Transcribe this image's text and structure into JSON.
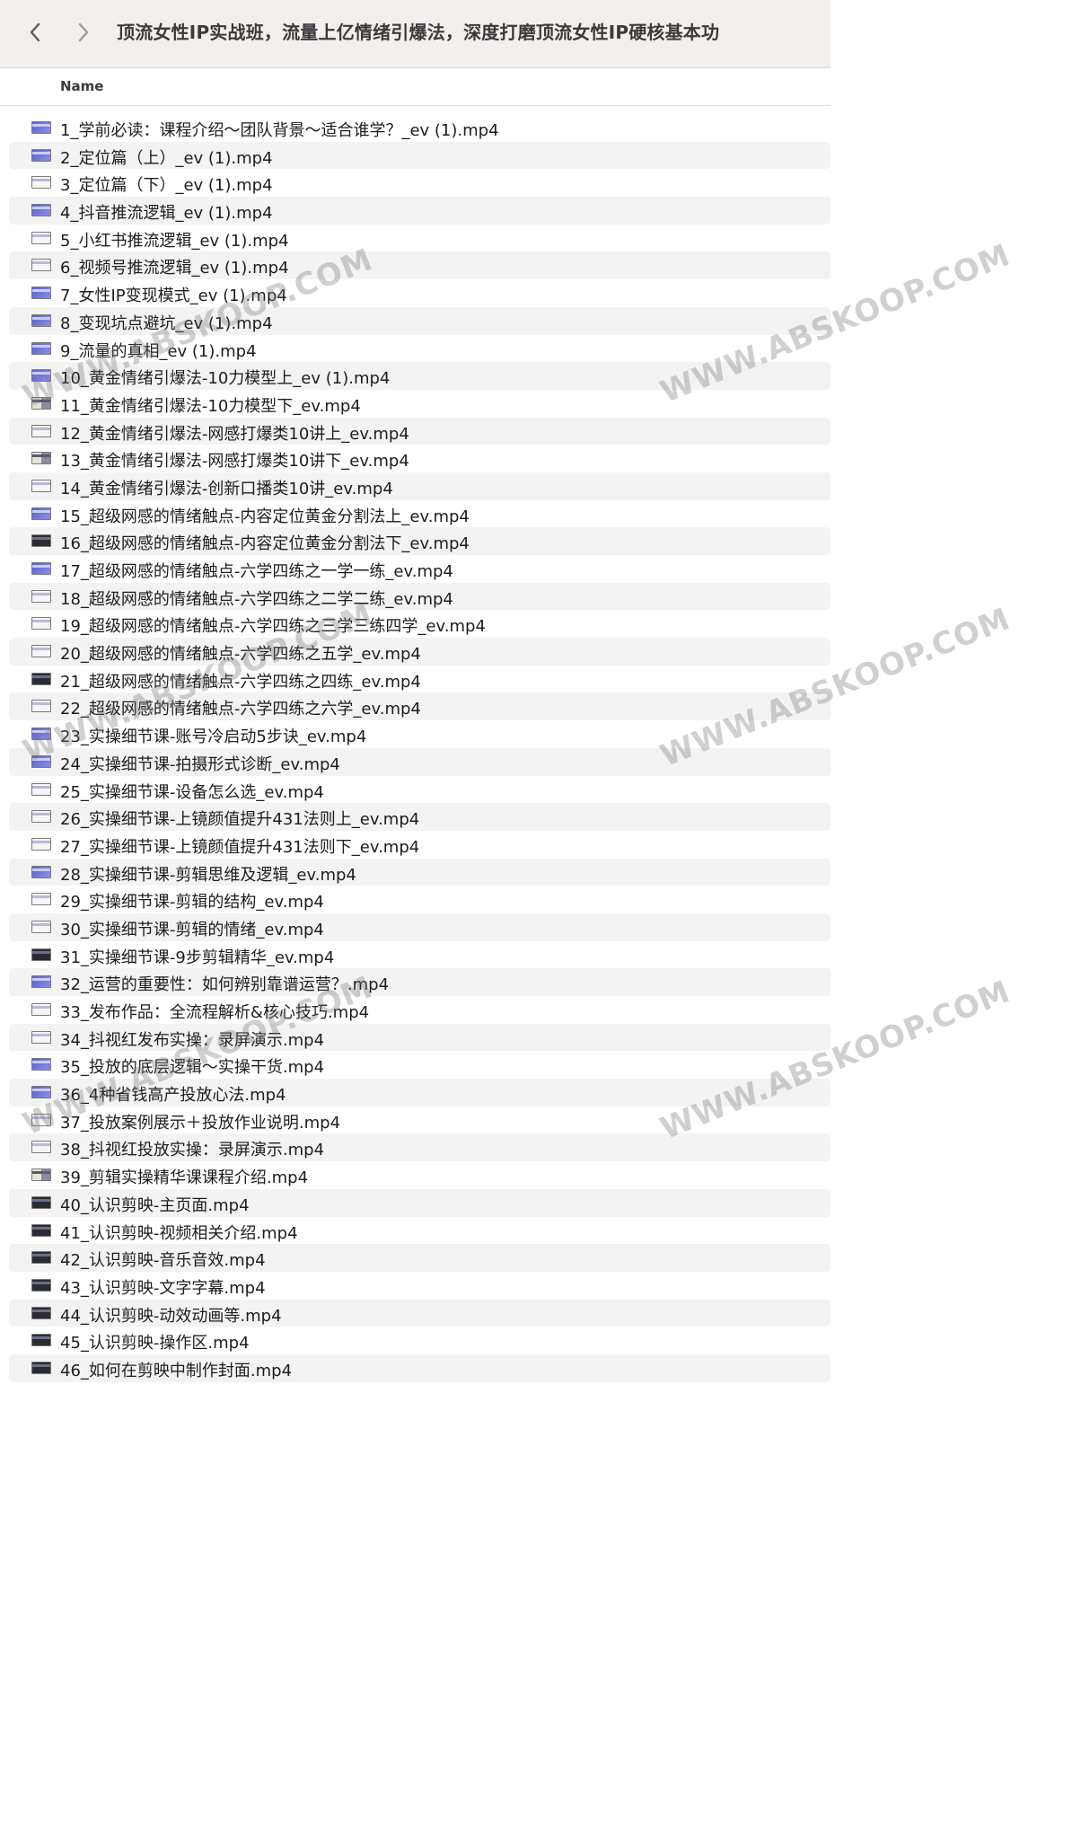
{
  "window": {
    "title": "顶流女性IP实战班，流量上亿情绪引爆法，深度打磨顶流女性IP硬核基本功"
  },
  "toolbar": {
    "back_icon": "chevron-left-icon",
    "forward_icon": "chevron-right-icon"
  },
  "columns": {
    "name": "Name"
  },
  "files": [
    {
      "name": "1_学前必读：课程介绍～团队背景～适合谁学？_ev (1).mp4",
      "thumb": "blue"
    },
    {
      "name": "2_定位篇（上）_ev (1).mp4",
      "thumb": "blue"
    },
    {
      "name": "3_定位篇（下）_ev (1).mp4",
      "thumb": "light"
    },
    {
      "name": "4_抖音推流逻辑_ev (1).mp4",
      "thumb": "blue"
    },
    {
      "name": "5_小红书推流逻辑_ev (1).mp4",
      "thumb": "light"
    },
    {
      "name": "6_视频号推流逻辑_ev (1).mp4",
      "thumb": "light"
    },
    {
      "name": "7_女性IP变现模式_ev (1).mp4",
      "thumb": "blue"
    },
    {
      "name": "8_变现坑点避坑_ev (1).mp4",
      "thumb": "blue"
    },
    {
      "name": "9_流量的真相_ev (1).mp4",
      "thumb": "blue"
    },
    {
      "name": "10_黄金情绪引爆法-10力模型上_ev (1).mp4",
      "thumb": "blue"
    },
    {
      "name": "11_黄金情绪引爆法-10力模型下_ev.mp4",
      "thumb": "mixed"
    },
    {
      "name": "12_黄金情绪引爆法-网感打爆类10讲上_ev.mp4",
      "thumb": "light"
    },
    {
      "name": "13_黄金情绪引爆法-网感打爆类10讲下_ev.mp4",
      "thumb": "mixed"
    },
    {
      "name": "14_黄金情绪引爆法-创新口播类10讲_ev.mp4",
      "thumb": "light"
    },
    {
      "name": "15_超级网感的情绪触点-内容定位黄金分割法上_ev.mp4",
      "thumb": "blue"
    },
    {
      "name": "16_超级网感的情绪触点-内容定位黄金分割法下_ev.mp4",
      "thumb": "dark"
    },
    {
      "name": "17_超级网感的情绪触点-六学四练之一学一练_ev.mp4",
      "thumb": "blue"
    },
    {
      "name": "18_超级网感的情绪触点-六学四练之二学二练_ev.mp4",
      "thumb": "light"
    },
    {
      "name": "19_超级网感的情绪触点-六学四练之三学三练四学_ev.mp4",
      "thumb": "light"
    },
    {
      "name": "20_超级网感的情绪触点-六学四练之五学_ev.mp4",
      "thumb": "light"
    },
    {
      "name": "21_超级网感的情绪触点-六学四练之四练_ev.mp4",
      "thumb": "dark"
    },
    {
      "name": "22_超级网感的情绪触点-六学四练之六学_ev.mp4",
      "thumb": "light"
    },
    {
      "name": "23_实操细节课-账号冷启动5步诀_ev.mp4",
      "thumb": "blue"
    },
    {
      "name": "24_实操细节课-拍摄形式诊断_ev.mp4",
      "thumb": "blue"
    },
    {
      "name": "25_实操细节课-设备怎么选_ev.mp4",
      "thumb": "light"
    },
    {
      "name": "26_实操细节课-上镜颜值提升431法则上_ev.mp4",
      "thumb": "light"
    },
    {
      "name": "27_实操细节课-上镜颜值提升431法则下_ev.mp4",
      "thumb": "light"
    },
    {
      "name": "28_实操细节课-剪辑思维及逻辑_ev.mp4",
      "thumb": "blue"
    },
    {
      "name": "29_实操细节课-剪辑的结构_ev.mp4",
      "thumb": "light"
    },
    {
      "name": "30_实操细节课-剪辑的情绪_ev.mp4",
      "thumb": "light"
    },
    {
      "name": "31_实操细节课-9步剪辑精华_ev.mp4",
      "thumb": "dark"
    },
    {
      "name": "32_运营的重要性：如何辨别靠谱运营？.mp4",
      "thumb": "blue"
    },
    {
      "name": "33_发布作品：全流程解析&核心技巧.mp4",
      "thumb": "light"
    },
    {
      "name": "34_抖视红发布实操：录屏演示.mp4",
      "thumb": "light"
    },
    {
      "name": "35_投放的底层逻辑～实操干货.mp4",
      "thumb": "blue"
    },
    {
      "name": "36_4种省钱高产投放心法.mp4",
      "thumb": "blue"
    },
    {
      "name": "37_投放案例展示＋投放作业说明.mp4",
      "thumb": "light"
    },
    {
      "name": "38_抖视红投放实操：录屏演示.mp4",
      "thumb": "light"
    },
    {
      "name": "39_剪辑实操精华课课程介绍.mp4",
      "thumb": "mixed"
    },
    {
      "name": "40_认识剪映-主页面.mp4",
      "thumb": "dark"
    },
    {
      "name": "41_认识剪映-视频相关介绍.mp4",
      "thumb": "dark"
    },
    {
      "name": "42_认识剪映-音乐音效.mp4",
      "thumb": "dark"
    },
    {
      "name": "43_认识剪映-文字字幕.mp4",
      "thumb": "dark"
    },
    {
      "name": "44_认识剪映-动效动画等.mp4",
      "thumb": "dark"
    },
    {
      "name": "45_认识剪映-操作区.mp4",
      "thumb": "dark"
    },
    {
      "name": "46_如何在剪映中制作封面.mp4",
      "thumb": "dark"
    }
  ],
  "watermark": "WWW.ABSKOOP.COM"
}
